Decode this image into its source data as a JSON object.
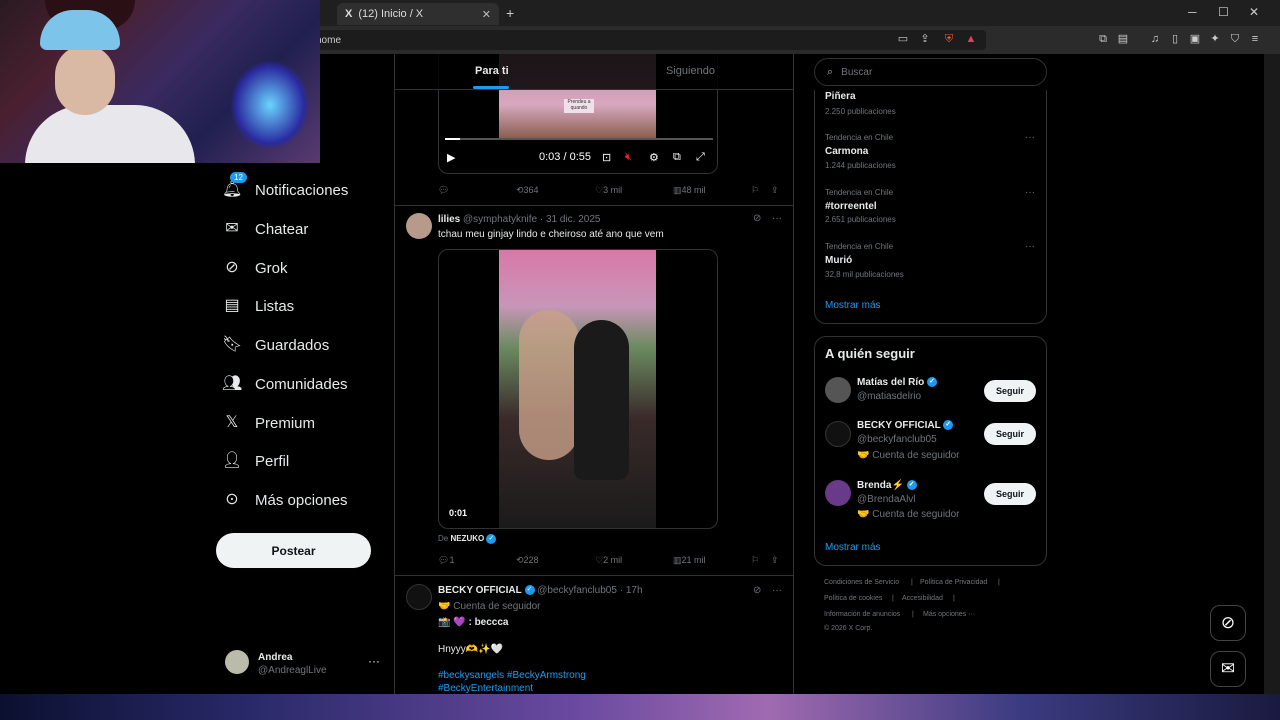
{
  "browser": {
    "tab_title": "(12) Inicio / X",
    "tab_icon": "X",
    "new_tab": "+",
    "url": "home",
    "window_controls": [
      "─",
      "☐",
      "✕"
    ]
  },
  "tabs": {
    "for_you": "Para ti",
    "following": "Siguiendo"
  },
  "nav": {
    "badge": "12",
    "items": [
      {
        "label": "Notificaciones",
        "icon": "bell-icon"
      },
      {
        "label": "Chatear",
        "icon": "mail-icon"
      },
      {
        "label": "Grok",
        "icon": "grok-icon"
      },
      {
        "label": "Listas",
        "icon": "list-icon"
      },
      {
        "label": "Guardados",
        "icon": "bookmark-icon"
      },
      {
        "label": "Comunidades",
        "icon": "communities-icon"
      },
      {
        "label": "Premium",
        "icon": "x-icon"
      },
      {
        "label": "Perfil",
        "icon": "person-icon"
      },
      {
        "label": "Más opciones",
        "icon": "more-circle-icon"
      }
    ],
    "post_button": "Postear"
  },
  "account": {
    "name": "Andrea",
    "handle": "@AndreaglLive"
  },
  "tweet1": {
    "video_overlay_text": "Prendeu a quando",
    "time": "0:03 / 0:55",
    "progress": 0.055,
    "replies": "",
    "retweets": "364",
    "likes": "3 mil",
    "views": "48 mil"
  },
  "tweet2": {
    "name": "lilies",
    "handle": "@symphatyknife",
    "date": "· 31 dic. 2025",
    "text": "tchau meu ginjay lindo e cheiroso até ano que vem",
    "video_time": "0:01",
    "from_prefix": "De",
    "from_name": "NEZUKO",
    "replies": "1",
    "retweets": "228",
    "likes": "2 mil",
    "views": "21 mil"
  },
  "tweet3": {
    "name": "BECKY OFFICIAL",
    "handle": "@beckyfanclub05",
    "date": "· 17h",
    "subscriber": "🤝 Cuenta de seguidor",
    "line1": "📸 💜 : beccca",
    "line2": "Hnyyy🫶✨🤍",
    "hashtags1": "#beckysangels #BeckyArmstrong",
    "hashtags2": "#BeckyEntertainment"
  },
  "search": {
    "placeholder": "Buscar"
  },
  "trends": [
    {
      "context": "",
      "name": "Piñera",
      "count": "2.250 publicaciones"
    },
    {
      "context": "Tendencia en Chile",
      "name": "Carmona",
      "count": "1.244 publicaciones"
    },
    {
      "context": "Tendencia en Chile",
      "name": "#torreentel",
      "count": "2.651 publicaciones"
    },
    {
      "context": "Tendencia en Chile",
      "name": "Murió",
      "count": "32,8 mil publicaciones"
    }
  ],
  "trends_show_more": "Mostrar más",
  "who_to_follow": {
    "title": "A quién seguir",
    "users": [
      {
        "name": "Matías del Río",
        "handle": "@matiasdelrio",
        "extra": "",
        "button": "Seguir"
      },
      {
        "name": "BECKY OFFICIAL",
        "handle": "@beckyfanclub05",
        "extra": "🤝 Cuenta de seguidor",
        "button": "Seguir"
      },
      {
        "name": "Brenda⚡",
        "handle": "@BrendaAlvl",
        "extra": "🤝 Cuenta de seguidor",
        "button": "Seguir"
      }
    ],
    "show_more": "Mostrar más"
  },
  "footer": {
    "links": [
      "Condiciones de Servicio",
      "|",
      "Política de Privacidad",
      "|",
      "Política de cookies",
      "|",
      "Accesibilidad",
      "|",
      "Información de anuncios",
      "|",
      "Más opciones ···"
    ],
    "copyright": "© 2026 X Corp."
  },
  "colors": {
    "accent": "#1d9bf0",
    "background": "#000000",
    "border": "#2f3336",
    "muted": "#71767b"
  }
}
